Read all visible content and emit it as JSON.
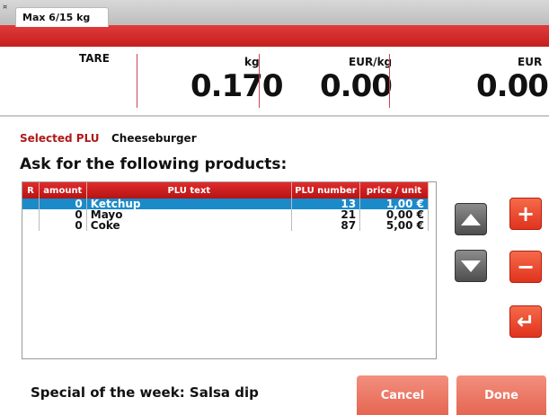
{
  "header": {
    "corner_mark": "¤",
    "max_tab": "Max 6/15 kg"
  },
  "weigh": {
    "tare_label": "TARE",
    "weight_unit": "kg",
    "weight_value": "0.170",
    "price_unit": "EUR/kg",
    "price_value": "0.00",
    "total_unit": "EUR",
    "total_value": "0.00"
  },
  "plu": {
    "label": "Selected PLU",
    "value": "Cheeseburger"
  },
  "prompt": "Ask for the following products:",
  "table": {
    "headers": [
      "R",
      "amount",
      "PLU text",
      "PLU number",
      "price / unit"
    ],
    "rows": [
      {
        "r": "",
        "amount": "0",
        "text": "Ketchup",
        "number": "13",
        "price": "1,00 €",
        "selected": true
      },
      {
        "r": "",
        "amount": "0",
        "text": "Mayo",
        "number": "21",
        "price": "0,00 €",
        "selected": false
      },
      {
        "r": "",
        "amount": "0",
        "text": "Coke",
        "number": "87",
        "price": "5,00 €",
        "selected": false
      }
    ]
  },
  "buttons": {
    "plus": "+",
    "minus": "−",
    "enter": "↵",
    "cancel": "Cancel",
    "done": "Done"
  },
  "special": "Special of the week: Salsa dip",
  "colors": {
    "accent_red": "#c81a1a",
    "selection_blue": "#1b8ac9",
    "action_orange": "#e8442a"
  }
}
